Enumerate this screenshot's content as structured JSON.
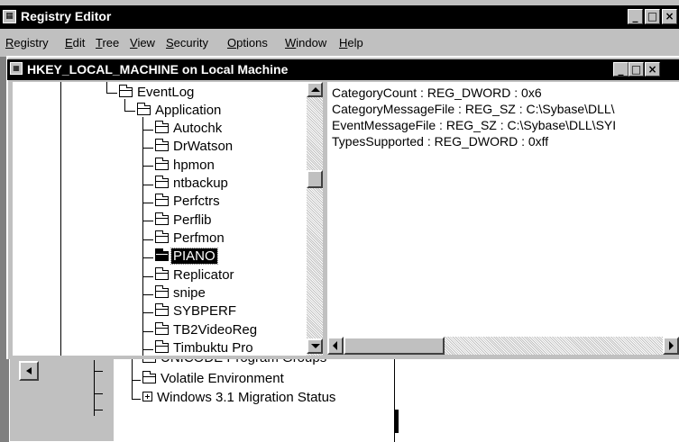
{
  "app": {
    "title": "Registry Editor",
    "icon_name": "regedit-icon",
    "window_buttons": [
      "_",
      "□",
      "×"
    ]
  },
  "menubar": [
    {
      "label": "Registry",
      "accel": "R"
    },
    {
      "label": "Edit",
      "accel": "E"
    },
    {
      "label": "Tree",
      "accel": "T"
    },
    {
      "label": "View",
      "accel": "V"
    },
    {
      "label": "Security",
      "accel": "S"
    },
    {
      "label": "Options",
      "accel": "O"
    },
    {
      "label": "Window",
      "accel": "W"
    },
    {
      "label": "Help",
      "accel": "H"
    }
  ],
  "child_window": {
    "title": "HKEY_LOCAL_MACHINE on Local Machine",
    "icon_name": "registry-key-icon",
    "window_buttons": [
      "_",
      "□",
      "×"
    ]
  },
  "tree": {
    "items": [
      {
        "label": "EventLog",
        "selected": false
      },
      {
        "label": "Application",
        "selected": false
      },
      {
        "label": "Autochk",
        "selected": false
      },
      {
        "label": "DrWatson",
        "selected": false
      },
      {
        "label": "hpmon",
        "selected": false
      },
      {
        "label": "ntbackup",
        "selected": false
      },
      {
        "label": "Perfctrs",
        "selected": false
      },
      {
        "label": "Perflib",
        "selected": false
      },
      {
        "label": "Perfmon",
        "selected": false
      },
      {
        "label": "PIANO",
        "selected": true
      },
      {
        "label": "Replicator",
        "selected": false
      },
      {
        "label": "snipe",
        "selected": false
      },
      {
        "label": "SYBPERF",
        "selected": false
      },
      {
        "label": "TB2VideoReg",
        "selected": false
      },
      {
        "label": "Timbuktu Pro",
        "selected": false
      }
    ]
  },
  "values": [
    "CategoryCount : REG_DWORD : 0x6",
    "CategoryMessageFile : REG_SZ : C:\\Sybase\\DLL\\",
    "EventMessageFile : REG_SZ : C:\\Sybase\\DLL\\SYI",
    "TypesSupported : REG_DWORD : 0xff"
  ],
  "background_window": {
    "items": [
      {
        "label": "UNICODE Program Groups"
      },
      {
        "label": "Volatile Environment"
      },
      {
        "label": "Windows 3.1 Migration Status"
      }
    ]
  }
}
